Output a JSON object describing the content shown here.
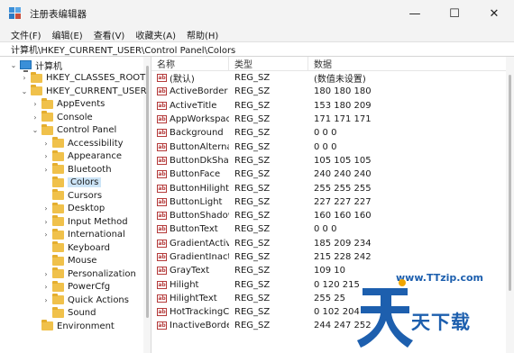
{
  "window": {
    "title": "注册表编辑器",
    "controls": {
      "minimize": "—",
      "maximize": "☐",
      "close": "✕"
    }
  },
  "menu": [
    "文件(F)",
    "编辑(E)",
    "查看(V)",
    "收藏夹(A)",
    "帮助(H)"
  ],
  "address": "计算机\\HKEY_CURRENT_USER\\Control Panel\\Colors",
  "tree": [
    {
      "label": "计算机",
      "level": 0,
      "expanded": true,
      "icon": "computer-icon"
    },
    {
      "label": "HKEY_CLASSES_ROOT",
      "level": 1,
      "expanded": false
    },
    {
      "label": "HKEY_CURRENT_USER",
      "level": 1,
      "expanded": true
    },
    {
      "label": "AppEvents",
      "level": 2,
      "expanded": false
    },
    {
      "label": "Console",
      "level": 2,
      "expanded": false
    },
    {
      "label": "Control Panel",
      "level": 2,
      "expanded": true
    },
    {
      "label": "Accessibility",
      "level": 3,
      "expanded": false
    },
    {
      "label": "Appearance",
      "level": 3,
      "expanded": false
    },
    {
      "label": "Bluetooth",
      "level": 3,
      "expanded": false
    },
    {
      "label": "Colors",
      "level": 3,
      "expanded": null,
      "selected": true
    },
    {
      "label": "Cursors",
      "level": 3,
      "expanded": null
    },
    {
      "label": "Desktop",
      "level": 3,
      "expanded": false
    },
    {
      "label": "Input Method",
      "level": 3,
      "expanded": false
    },
    {
      "label": "International",
      "level": 3,
      "expanded": false
    },
    {
      "label": "Keyboard",
      "level": 3,
      "expanded": null
    },
    {
      "label": "Mouse",
      "level": 3,
      "expanded": null
    },
    {
      "label": "Personalization",
      "level": 3,
      "expanded": false
    },
    {
      "label": "PowerCfg",
      "level": 3,
      "expanded": false
    },
    {
      "label": "Quick Actions",
      "level": 3,
      "expanded": false
    },
    {
      "label": "Sound",
      "level": 3,
      "expanded": null
    },
    {
      "label": "Environment",
      "level": 2,
      "expanded": null
    }
  ],
  "columns": {
    "name": "名称",
    "type": "类型",
    "data": "数据"
  },
  "values": [
    {
      "name": "(默认)",
      "type": "REG_SZ",
      "data": "(数值未设置)"
    },
    {
      "name": "ActiveBorder",
      "type": "REG_SZ",
      "data": "180 180 180"
    },
    {
      "name": "ActiveTitle",
      "type": "REG_SZ",
      "data": "153 180 209"
    },
    {
      "name": "AppWorkspace",
      "type": "REG_SZ",
      "data": "171 171 171"
    },
    {
      "name": "Background",
      "type": "REG_SZ",
      "data": "0 0 0"
    },
    {
      "name": "ButtonAlternat...",
      "type": "REG_SZ",
      "data": "0 0 0"
    },
    {
      "name": "ButtonDkShad...",
      "type": "REG_SZ",
      "data": "105 105 105"
    },
    {
      "name": "ButtonFace",
      "type": "REG_SZ",
      "data": "240 240 240"
    },
    {
      "name": "ButtonHilight",
      "type": "REG_SZ",
      "data": "255 255 255"
    },
    {
      "name": "ButtonLight",
      "type": "REG_SZ",
      "data": "227 227 227"
    },
    {
      "name": "ButtonShadow",
      "type": "REG_SZ",
      "data": "160 160 160"
    },
    {
      "name": "ButtonText",
      "type": "REG_SZ",
      "data": "0 0 0"
    },
    {
      "name": "GradientActive...",
      "type": "REG_SZ",
      "data": "185 209 234"
    },
    {
      "name": "GradientInactiv...",
      "type": "REG_SZ",
      "data": "215 228 242"
    },
    {
      "name": "GrayText",
      "type": "REG_SZ",
      "data": "109 10"
    },
    {
      "name": "Hilight",
      "type": "REG_SZ",
      "data": "0 120 215"
    },
    {
      "name": "HilightText",
      "type": "REG_SZ",
      "data": "255 25"
    },
    {
      "name": "HotTrackingCo...",
      "type": "REG_SZ",
      "data": "0 102 204"
    },
    {
      "name": "InactiveBorder",
      "type": "REG_SZ",
      "data": "244 247 252"
    }
  ],
  "watermark": {
    "url": "www.TTzip.com",
    "text": "天下载"
  },
  "colors": {
    "folder": "#f0c14b",
    "selection": "#cce4f7",
    "watermark": "#1d5fae"
  }
}
